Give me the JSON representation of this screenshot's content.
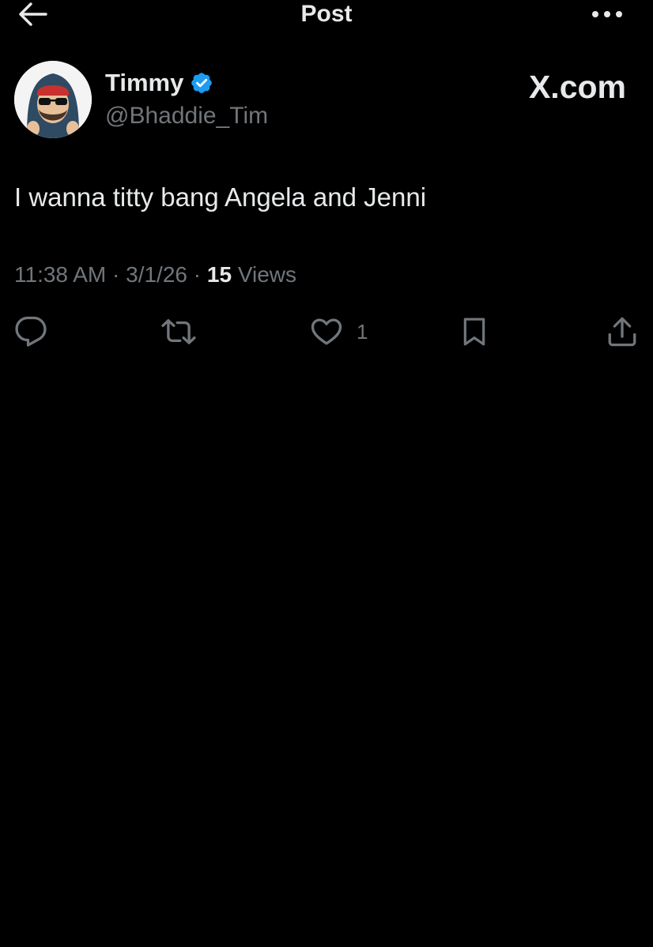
{
  "header": {
    "title": "Post",
    "back_icon": "arrow-left-icon",
    "more_icon": "more-horizontal-icon"
  },
  "author": {
    "display_name": "Timmy",
    "handle": "@Bhaddie_Tim",
    "verified_icon": "verified-badge-icon",
    "verified_color": "#1d9bf0"
  },
  "watermark": "X.com",
  "post": {
    "text": "I wanna titty bang Angela and Jenni",
    "time": "11:38 AM",
    "sep1": "·",
    "date": "3/1/26",
    "sep2": "·",
    "views_count": "15",
    "views_label": "Views"
  },
  "actions": {
    "reply_icon": "reply-icon",
    "repost_icon": "repost-icon",
    "like_icon": "heart-icon",
    "like_count": "1",
    "bookmark_icon": "bookmark-icon",
    "share_icon": "share-icon"
  },
  "colors": {
    "background": "#000000",
    "text_primary": "#e7e9ea",
    "text_secondary": "#71767b",
    "accent": "#1d9bf0"
  }
}
